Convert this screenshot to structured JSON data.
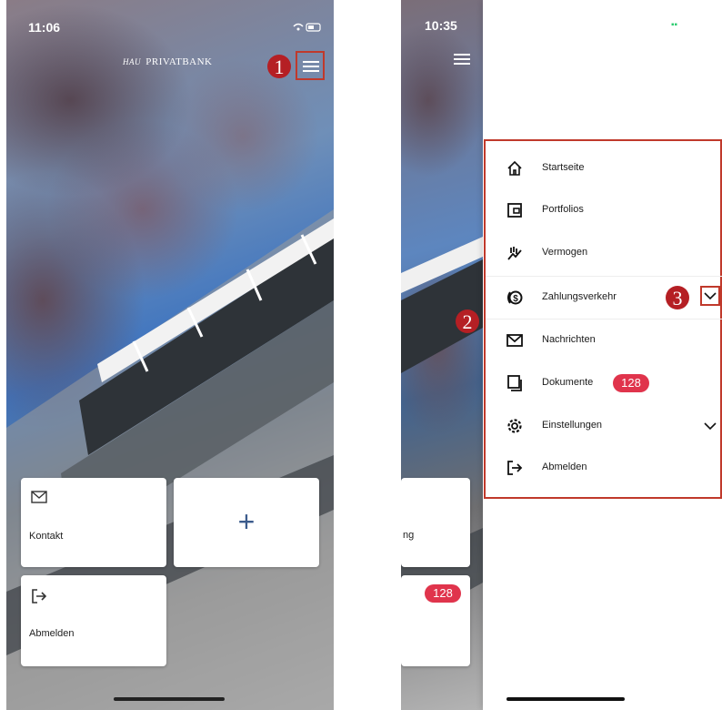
{
  "left_phone": {
    "status_time": "11:06",
    "logo_text": "PRIVATBANK",
    "logo_prefix": "HAU",
    "marker_number": "1",
    "cards": {
      "kontakt_label": "Kontakt",
      "add_symbol": "+",
      "abmelden_label": "Abmelden"
    }
  },
  "right_phone": {
    "status_time": "10:35",
    "battery_glyph": "▪▪",
    "partial_card_text": "ng",
    "partial_badge": "128",
    "menu": {
      "items": [
        {
          "label": "Startseite",
          "icon": "home-icon"
        },
        {
          "label": "Portfolios",
          "icon": "wallet-icon"
        },
        {
          "label": "Vermogen",
          "icon": "chart-icon"
        },
        {
          "label": "Zahlungsverkehr",
          "icon": "payment-icon"
        },
        {
          "label": "Nachrichten",
          "icon": "mail-icon"
        },
        {
          "label": "Dokumente",
          "icon": "documents-icon",
          "badge": "128"
        },
        {
          "label": "Einstellungen",
          "icon": "gear-icon"
        },
        {
          "label": "Abmelden",
          "icon": "logout-icon"
        }
      ]
    },
    "marker_two": "2",
    "marker_three": "3"
  },
  "colors": {
    "marker_red": "#b51f24",
    "badge_red": "#e0344c",
    "accent_blue": "#3b5b8c"
  }
}
